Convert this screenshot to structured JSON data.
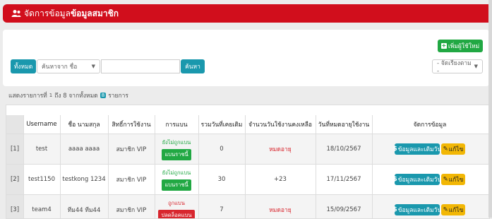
{
  "header": {
    "title_prefix": "จัดการข้อมูล",
    "title_bold": "ข้อมูลสมาชิก",
    "icon": "users-icon"
  },
  "toolbar": {
    "add_button": "เพิ่มผู้ใช้ใหม่",
    "all_button": "ทั้งหมด",
    "search_field_select": "ค้นหาจาก ชื่อ",
    "search_input_value": "",
    "search_button": "ค้นหา",
    "sort_select": "- จัดเรียงตาม -"
  },
  "info": {
    "prefix": "แสดงรายการที่",
    "from": "1",
    "mid": "ถึง 8 จากทั้งหมด",
    "total": "8",
    "suffix": "รายการ"
  },
  "table": {
    "columns": [
      "Username",
      "ชื่อ นามสกุล",
      "สิทธิ์การใช้งาน",
      "การแบน",
      "รวมวันที่เคยเติม",
      "จำนวนวันใช้งานคงเหลือ",
      "วันที่หมดอายุใช้งาน",
      "จัดการข้อมูล"
    ],
    "rows": [
      {
        "idx": "[1]",
        "username": "test",
        "name": "aaaa aaaa",
        "role": "สมาชิก VIP",
        "ban_status": "ยังไม่ถูกแบน",
        "ban_button": "แบนราชนี้",
        "ban_state": "ok",
        "total_days": "0",
        "remaining": "หมดอายุ",
        "remaining_expired": true,
        "expiry": "18/10/2567",
        "topup_button": "ข้อมูลและเติมวัน",
        "edit_button": "แก้ไข"
      },
      {
        "idx": "[2]",
        "username": "test1150",
        "name": "testkong 1234",
        "role": "สมาชิก VIP",
        "ban_status": "ยังไม่ถูกแบน",
        "ban_button": "แบนราชนี้",
        "ban_state": "ok",
        "total_days": "30",
        "remaining": "+23",
        "remaining_expired": false,
        "expiry": "17/11/2567",
        "topup_button": "ข้อมูลและเติมวัน",
        "edit_button": "แก้ไข"
      },
      {
        "idx": "[3]",
        "username": "team4",
        "name": "ทีม44 ทีม44",
        "role": "สมาชิก VIP",
        "ban_status": "ถูกแบน",
        "ban_button": "ปลดล็อคแบน",
        "ban_state": "banned",
        "total_days": "7",
        "remaining": "หมดอายุ",
        "remaining_expired": true,
        "expiry": "15/09/2567",
        "topup_button": "ข้อมูลและเติมวัน",
        "edit_button": "แก้ไข"
      }
    ]
  },
  "colors": {
    "header_red": "#d10e1c",
    "green": "#21a843",
    "teal": "#1a98ad",
    "yellow": "#f2b705",
    "red": "#d8262e"
  }
}
